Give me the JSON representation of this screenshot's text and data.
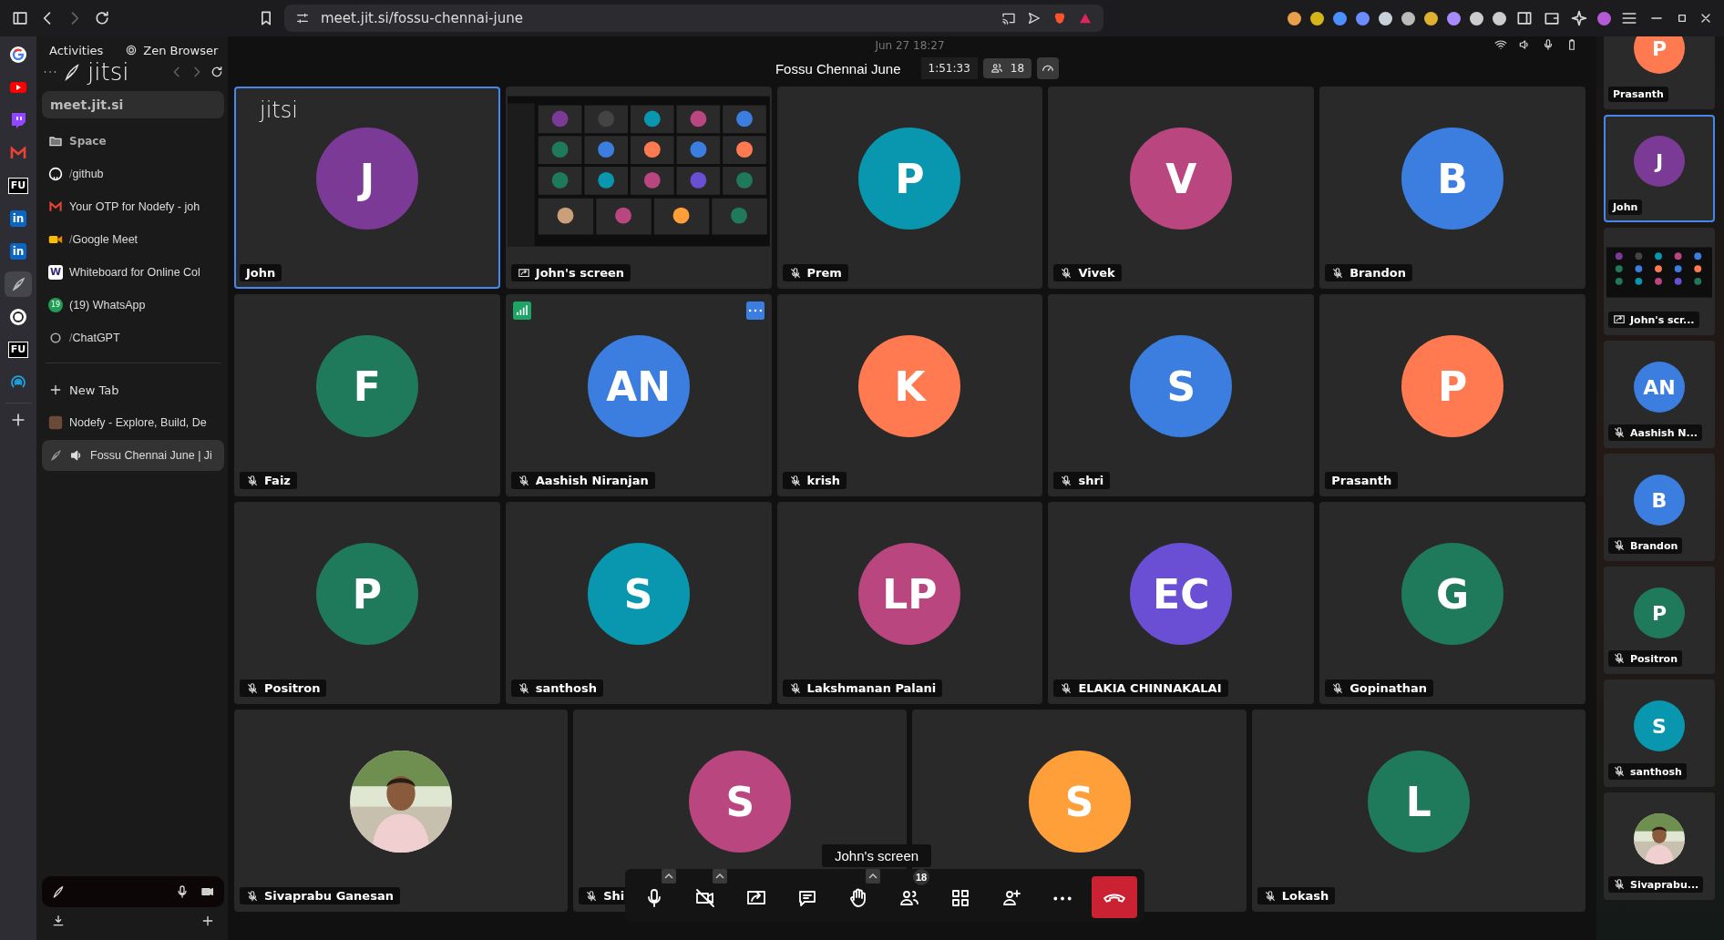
{
  "browser": {
    "url": "meet.jit.si/fossu-chennai-june"
  },
  "essentials": [
    {
      "kind": "google",
      "selected": false
    },
    {
      "kind": "youtube",
      "selected": false
    },
    {
      "kind": "twitch",
      "selected": false
    },
    {
      "kind": "gmail",
      "selected": false
    },
    {
      "kind": "fu",
      "label": "FU",
      "selected": false
    },
    {
      "kind": "linkedin",
      "label": "in",
      "selected": false
    },
    {
      "kind": "linkedin",
      "label": "in",
      "selected": false
    },
    {
      "kind": "jitsi",
      "selected": true
    },
    {
      "kind": "chatgpt",
      "selected": false
    },
    {
      "kind": "fu",
      "label": "FU",
      "selected": false
    },
    {
      "kind": "signal",
      "selected": false
    }
  ],
  "desktop": {
    "activities": "Activities",
    "app": "Zen Browser",
    "clock": "Jun 27  18:27"
  },
  "sidebar": {
    "logo": "jitsi",
    "url": "meet.jit.si",
    "space": "Space",
    "pinned_tabs": [
      {
        "kind": "github",
        "prefix": "/",
        "label": "github",
        "selected": false
      },
      {
        "kind": "gmail",
        "label": "Your OTP for Nodefy - joh",
        "selected": false
      },
      {
        "kind": "meet",
        "prefix": "/",
        "label": "Google Meet",
        "selected": false
      },
      {
        "kind": "whiteboard",
        "icon_label": "W",
        "label": "Whiteboard for Online Col",
        "selected": false
      },
      {
        "kind": "whatsapp",
        "icon_label": "19",
        "label": "(19) WhatsApp",
        "selected": false
      },
      {
        "kind": "chatgpt",
        "prefix": "/",
        "label": "ChatGPT",
        "selected": false
      }
    ],
    "new_tab": "New Tab",
    "tabs": [
      {
        "kind": "nodefy",
        "label": "Nodefy - Explore, Build, De",
        "playing": false,
        "selected": false
      },
      {
        "kind": "jitsi",
        "label": "Fossu Chennai June | Ji",
        "playing": true,
        "selected": true
      }
    ]
  },
  "meeting": {
    "title": "Fossu Chennai June",
    "timer": "1:51:33",
    "participant_count": "18"
  },
  "tiles": [
    {
      "kind": "avatar",
      "initials": "J",
      "color": "#7b3a96",
      "name": "John",
      "muted": false,
      "selected": true,
      "logo": "jitsi",
      "hovered": false
    },
    {
      "kind": "screen",
      "name": "John's screen",
      "muted": false,
      "selected": false,
      "hovered": false
    },
    {
      "kind": "avatar",
      "initials": "P",
      "color": "#0897ae",
      "name": "Prem",
      "muted": true,
      "selected": false,
      "hovered": false
    },
    {
      "kind": "avatar",
      "initials": "V",
      "color": "#b9467f",
      "name": "Vivek",
      "muted": true,
      "selected": false,
      "hovered": false
    },
    {
      "kind": "avatar",
      "initials": "B",
      "color": "#3b7ee0",
      "name": "Brandon",
      "muted": true,
      "selected": false,
      "hovered": false
    },
    {
      "kind": "avatar",
      "initials": "F",
      "color": "#1f7a5c",
      "name": "Faiz",
      "muted": true,
      "selected": false,
      "hovered": false
    },
    {
      "kind": "avatar",
      "initials": "AN",
      "color": "#3b7ee0",
      "name": "Aashish Niranjan",
      "muted": true,
      "selected": false,
      "hovered": true
    },
    {
      "kind": "avatar",
      "initials": "K",
      "color": "#ff7a50",
      "name": "krish",
      "muted": true,
      "selected": false,
      "hovered": false
    },
    {
      "kind": "avatar",
      "initials": "S",
      "color": "#3b7ee0",
      "name": "shri",
      "muted": true,
      "selected": false,
      "hovered": false
    },
    {
      "kind": "avatar",
      "initials": "P",
      "color": "#ff7a50",
      "name": "Prasanth",
      "muted": false,
      "selected": false,
      "hovered": false
    },
    {
      "kind": "avatar",
      "initials": "P",
      "color": "#1f7a5c",
      "name": "Positron",
      "muted": true,
      "selected": false,
      "hovered": false
    },
    {
      "kind": "avatar",
      "initials": "S",
      "color": "#0897ae",
      "name": "santhosh",
      "muted": true,
      "selected": false,
      "hovered": false
    },
    {
      "kind": "avatar",
      "initials": "LP",
      "color": "#b9467f",
      "name": "Lakshmanan Palani",
      "muted": true,
      "selected": false,
      "hovered": false
    },
    {
      "kind": "avatar",
      "initials": "EC",
      "color": "#6a4fd4",
      "name": "ELAKIA CHINNAKALAI",
      "muted": true,
      "selected": false,
      "hovered": false
    },
    {
      "kind": "avatar",
      "initials": "G",
      "color": "#1f7a5c",
      "name": "Gopinathan",
      "muted": true,
      "selected": false,
      "hovered": false
    },
    {
      "name": "Sivaprabu Ganesan",
      "muted": true,
      "selected": false,
      "hovered": false
    },
    {
      "kind": "avatar",
      "initials": "S",
      "color": "#b9467f",
      "name": "Shi",
      "muted": true,
      "selected": false,
      "hovered": false
    },
    {
      "kind": "avatar",
      "initials": "S",
      "color": "#ff9f3a",
      "muted": false,
      "selected": false,
      "hovered": false
    },
    {
      "kind": "avatar",
      "initials": "L",
      "color": "#1f7a5c",
      "name": "Lokash",
      "muted": true,
      "selected": false,
      "hovered": false
    }
  ],
  "toolbar": {
    "tooltip": "John's screen",
    "participants_badge": "18",
    "buttons": [
      {
        "kind": "mic",
        "caret": true
      },
      {
        "kind": "camera-off",
        "caret": true
      },
      {
        "kind": "share",
        "caret": false
      },
      {
        "kind": "chat",
        "caret": false
      },
      {
        "kind": "hand",
        "caret": true
      },
      {
        "kind": "participants",
        "caret": false
      },
      {
        "kind": "tiles",
        "caret": false
      },
      {
        "kind": "invite",
        "caret": false
      },
      {
        "kind": "more",
        "caret": false
      },
      {
        "kind": "hangup",
        "caret": false
      }
    ]
  },
  "filmstrip": [
    {
      "kind": "avatar",
      "initials": "P",
      "color": "#ff7a50",
      "name": "Prasanth",
      "muted": false,
      "selected": false
    },
    {
      "kind": "avatar",
      "initials": "J",
      "color": "#7b3a96",
      "name": "John",
      "muted": false,
      "selected": true
    },
    {
      "kind": "screen",
      "name": "John's scr...",
      "muted": false,
      "selected": false
    },
    {
      "kind": "avatar",
      "initials": "AN",
      "color": "#3b7ee0",
      "name": "Aashish N...",
      "muted": true,
      "selected": false
    },
    {
      "kind": "avatar",
      "initials": "B",
      "color": "#3b7ee0",
      "name": "Brandon",
      "muted": true,
      "selected": false
    },
    {
      "kind": "avatar",
      "initials": "P",
      "color": "#1f7a5c",
      "name": "Positron",
      "muted": true,
      "selected": false
    },
    {
      "kind": "avatar",
      "initials": "S",
      "color": "#0897ae",
      "name": "santhosh",
      "muted": true,
      "selected": false
    },
    {
      "name": "Sivaprabu...",
      "muted": true,
      "selected": false
    }
  ]
}
